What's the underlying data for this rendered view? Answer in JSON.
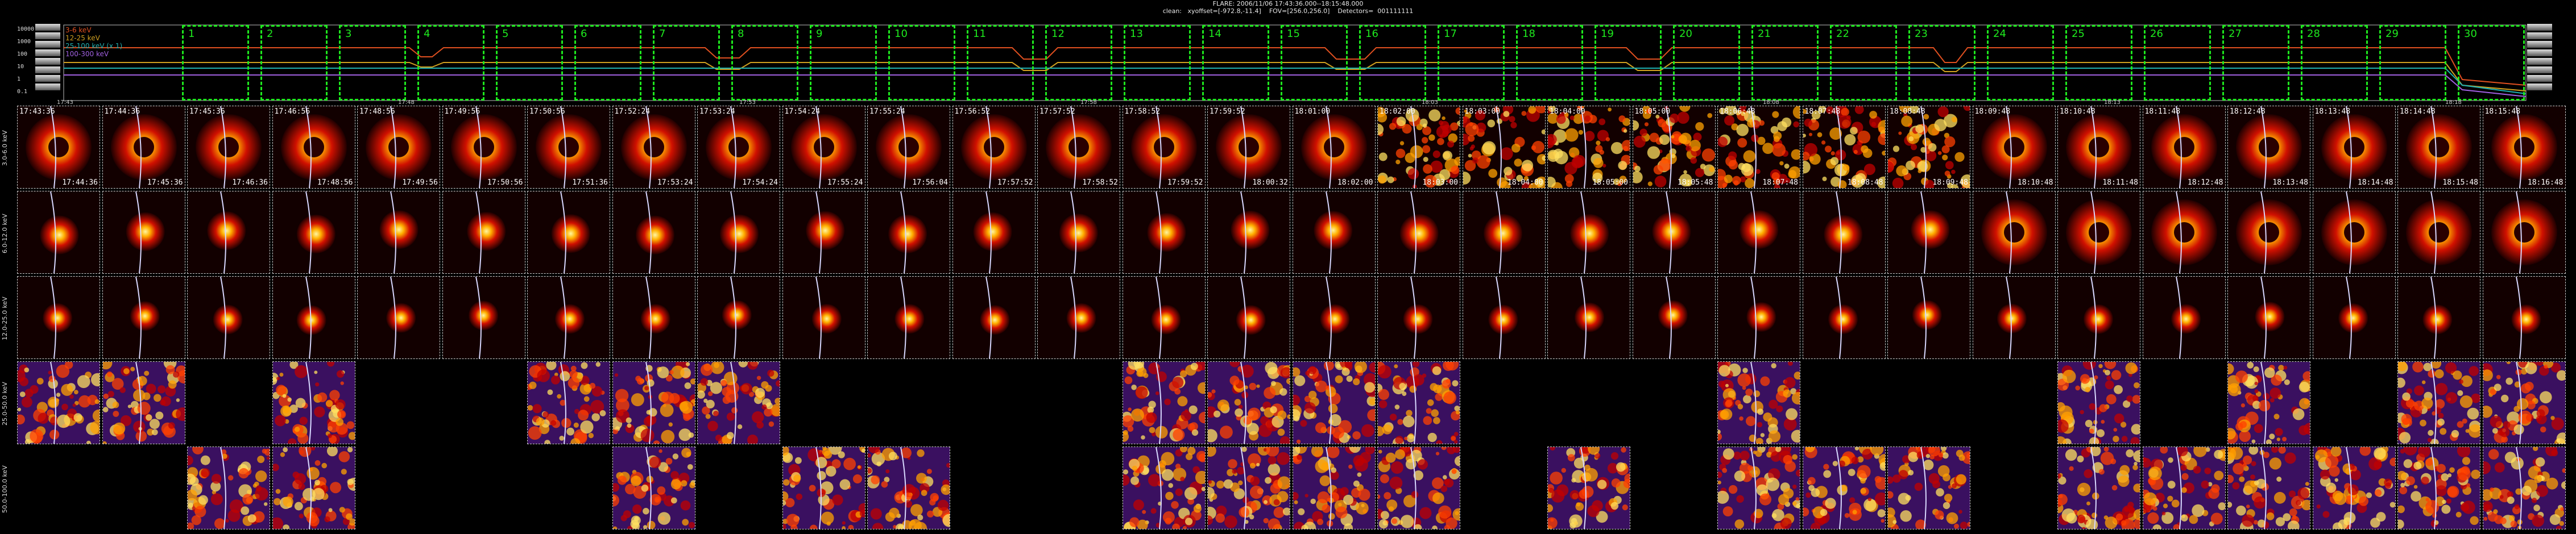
{
  "header": {
    "line1": "FLARE: 2006/11/06 17:43:36.000--18:15:48.000",
    "line2": "clean:   xyoffset=[-972.8,-11.4]    FOV=[256.0,256.0]    Detectors=  001111111"
  },
  "lightcurve": {
    "y_tick_labels": [
      "10000",
      "1000",
      "100",
      "10",
      "1",
      "0.1"
    ],
    "legend": [
      {
        "label": "3-6 keV",
        "color": "#e05020"
      },
      {
        "label": "12-25 keV",
        "color": "#d0a020"
      },
      {
        "label": "25-100 keV (x 1)",
        "color": "#20b0b0"
      },
      {
        "label": "100-300 keV",
        "color": "#a060e0"
      }
    ],
    "time_ticks": [
      "17:43",
      "17:48",
      "17:53",
      "17:58",
      "18:03",
      "18:08",
      "18:13",
      "18:18"
    ],
    "segment_labels": [
      "1",
      "2",
      "3",
      "4",
      "5",
      "6",
      "7",
      "8",
      "9",
      "10",
      "11",
      "12",
      "13",
      "14",
      "15",
      "16",
      "17",
      "18",
      "19",
      "20",
      "21",
      "22",
      "23",
      "24",
      "25",
      "26",
      "27",
      "28",
      "29",
      "30"
    ]
  },
  "energy_bands": [
    "3.0-6.0 keV",
    "6.0-12.0 keV",
    "12.0-25.0 keV",
    "25.0-50.0 keV",
    "50.0-100.0 keV"
  ],
  "row1_top_times": [
    "17:43:36",
    "17:44:36",
    "17:45:36",
    "17:46:56",
    "17:48:56",
    "17:49:56",
    "17:50:56",
    "17:52:24",
    "17:53:24",
    "17:54:24",
    "17:55:24",
    "17:56:52",
    "17:57:52",
    "17:58:52",
    "17:59:52",
    "18:01:00",
    "18:02:00",
    "18:03:00",
    "18:04:00",
    "18:05:00",
    "18:06:48",
    "18:07:48",
    "18:08:48",
    "18:09:48",
    "18:10:48",
    "18:11:48",
    "18:12:48",
    "18:13:48",
    "18:14:48",
    "18:15:48"
  ],
  "row1_bottom_times": [
    "17:44:36",
    "17:45:36",
    "17:46:36",
    "17:48:56",
    "17:49:56",
    "17:50:56",
    "17:51:36",
    "17:53:24",
    "17:54:24",
    "17:55:24",
    "17:56:04",
    "17:57:52",
    "17:58:52",
    "17:59:52",
    "18:00:32",
    "18:02:00",
    "18:03:00",
    "18:04:00",
    "18:05:00",
    "18:05:48",
    "18:07:48",
    "18:08:48",
    "18:09:48",
    "18:10:48",
    "18:11:48",
    "18:12:48",
    "18:13:48",
    "18:14:48",
    "18:15:48",
    "18:16:48"
  ],
  "grid_presence": {
    "row4": [
      1,
      1,
      0,
      1,
      0,
      0,
      1,
      1,
      1,
      0,
      0,
      0,
      0,
      1,
      1,
      1,
      1,
      0,
      0,
      0,
      1,
      0,
      0,
      0,
      1,
      0,
      1,
      0,
      1,
      1
    ],
    "row5": [
      0,
      0,
      1,
      1,
      0,
      0,
      0,
      1,
      0,
      1,
      1,
      0,
      0,
      1,
      1,
      1,
      1,
      0,
      1,
      0,
      1,
      1,
      1,
      0,
      1,
      1,
      1,
      1,
      1,
      1
    ]
  },
  "colors": {
    "segment_box": "#1eea1e",
    "tile_border": "#cfcfcf",
    "limb_line": "#d8d8ff"
  }
}
